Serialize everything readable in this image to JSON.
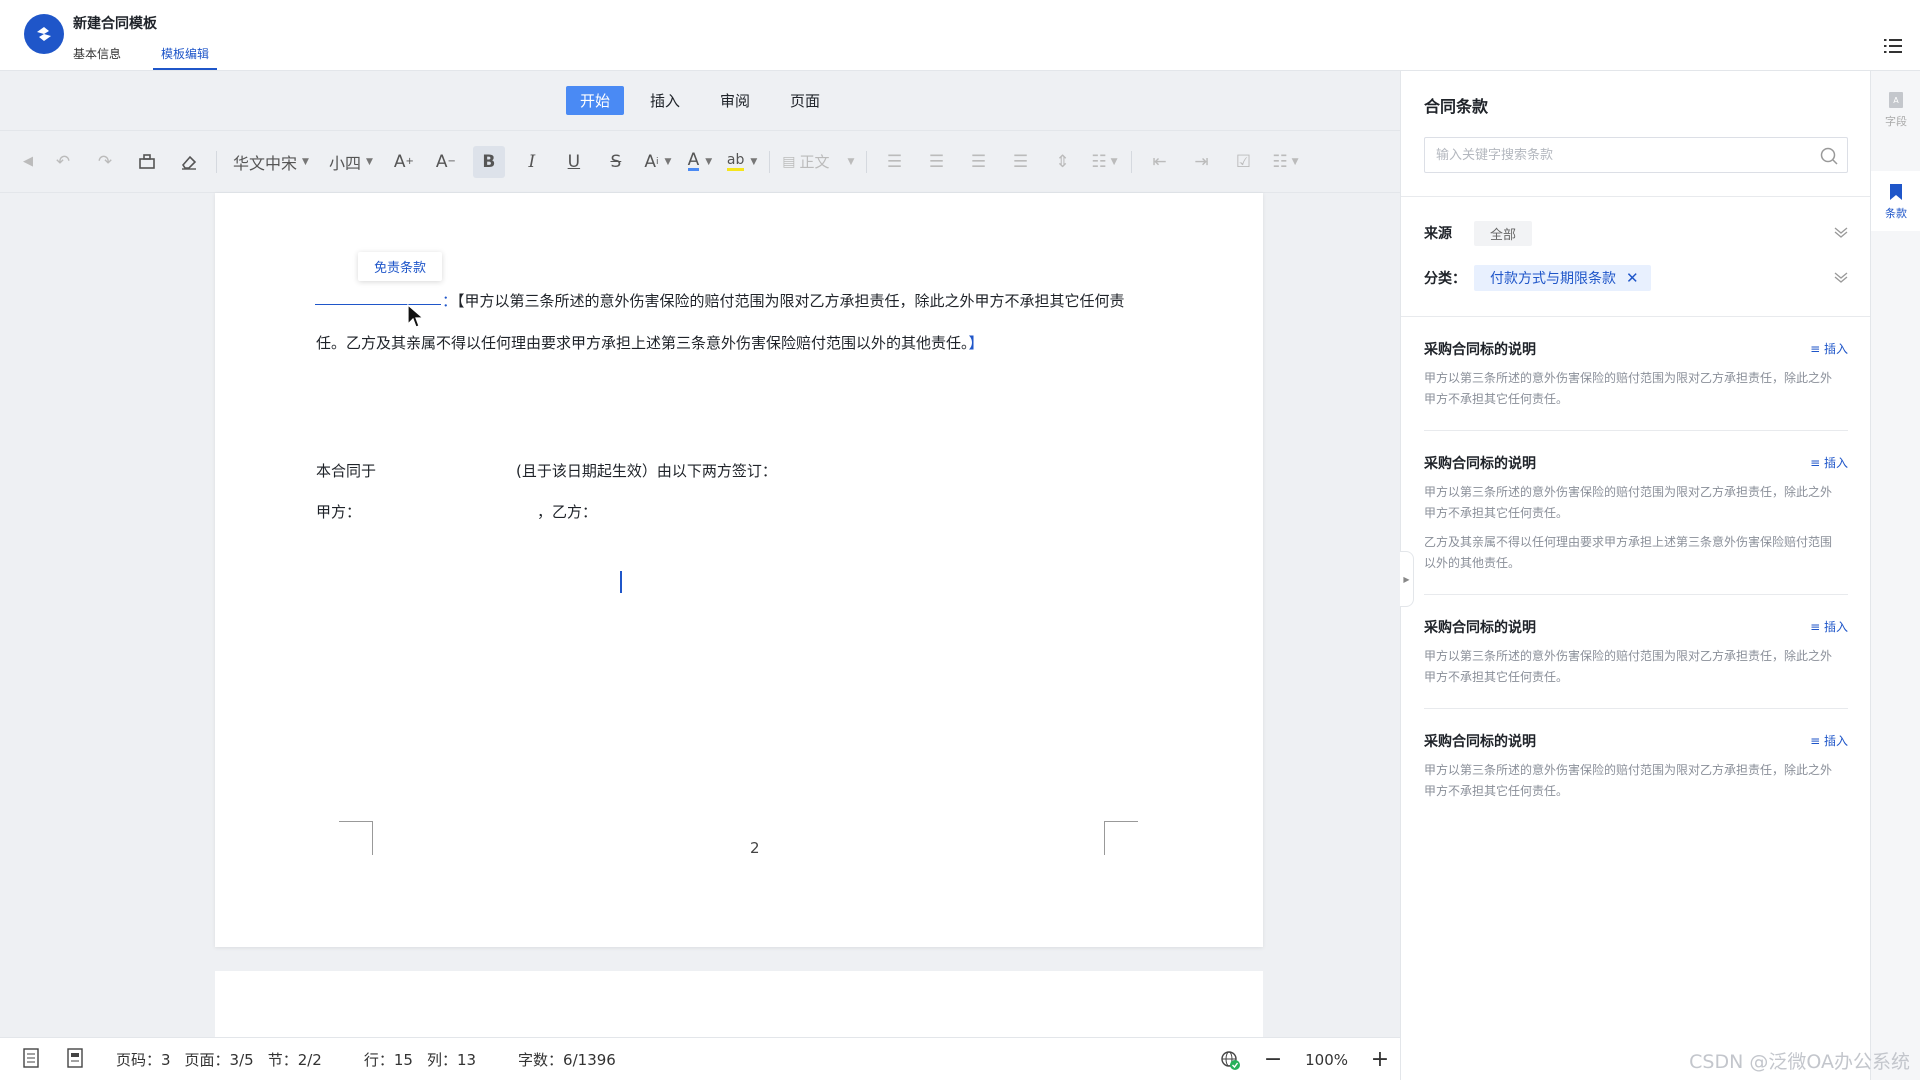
{
  "header": {
    "title": "新建合同模板",
    "tabs": [
      {
        "label": "基本信息"
      },
      {
        "label": "模板编辑"
      }
    ],
    "active_tab": "模板编辑"
  },
  "menu_tabs": [
    {
      "label": "开始"
    },
    {
      "label": "插入"
    },
    {
      "label": "审阅"
    },
    {
      "label": "页面"
    }
  ],
  "active_menu": "开始",
  "toolbar": {
    "font_family": "华文中宋",
    "font_size": "小四",
    "paragraph_style": "正文",
    "font_color": "#4a8af4",
    "highlight_color": "#f5e51b",
    "icons": [
      "back-icon",
      "undo-icon",
      "redo-icon",
      "format-painter-icon",
      "eraser-icon",
      "increase-font-icon",
      "decrease-font-icon",
      "bold-icon",
      "italic-icon",
      "underline-icon",
      "strikethrough-icon",
      "superscript-icon",
      "font-color-icon",
      "highlight-icon",
      "paragraph-style-icon",
      "align-left-icon",
      "align-center-icon",
      "align-right-icon",
      "justify-icon",
      "line-spacing-icon",
      "paragraph-spacing-icon",
      "outdent-icon",
      "indent-icon",
      "checkbox-icon",
      "bulleted-list-icon"
    ]
  },
  "document": {
    "clause_tag": "免责条款",
    "colon": "：",
    "clause_line1": "【甲方以第三条所述的意外伤害保险的赔付范围为限对乙方承担责任，除此之外甲方不承担其它任何责",
    "clause_line2": "任。乙方及其亲属不得以任何理由要求甲方承担上述第三条意外伤害保险赔付范围以外的其他责任。",
    "clause_close": "】",
    "sign_line_a": "本合同于",
    "sign_line_b": "(且于该日期起生效）由以下两方签订：",
    "party_a": "甲方：",
    "party_b": "，乙方：",
    "page_number": "2"
  },
  "statusbar": {
    "page_code": "页码：3",
    "pages": "页面：3/5",
    "section": "节：2/2",
    "row": "行：15",
    "col": "列：13",
    "word_count": "字数：6/1396",
    "zoom": "100%",
    "zoom_out": "−",
    "zoom_in": "+"
  },
  "panel": {
    "title": "合同条款",
    "search_placeholder": "输入关键字搜索条款",
    "source_label": "来源",
    "source_value": "全部",
    "category_label": "分类：",
    "category_value": "付款方式与期限条款",
    "category_close": "✕",
    "insert_label": "插入",
    "clauses": [
      {
        "title": "采购合同标的说明",
        "desc": [
          "甲方以第三条所述的意外伤害保险的赔付范围为限对乙方承担责任，除此之外甲方不承担其它任何责任。"
        ]
      },
      {
        "title": "采购合同标的说明",
        "desc": [
          "甲方以第三条所述的意外伤害保险的赔付范围为限对乙方承担责任，除此之外甲方不承担其它任何责任。",
          "乙方及其亲属不得以任何理由要求甲方承担上述第三条意外伤害保险赔付范围以外的其他责任。"
        ]
      },
      {
        "title": "采购合同标的说明",
        "desc": [
          "甲方以第三条所述的意外伤害保险的赔付范围为限对乙方承担责任，除此之外甲方不承担其它任何责任。"
        ]
      },
      {
        "title": "采购合同标的说明",
        "desc": [
          "甲方以第三条所述的意外伤害保险的赔付范围为限对乙方承担责任，除此之外甲方不承担其它任何责任。"
        ]
      }
    ]
  },
  "strip": {
    "field_label": "字段",
    "clause_label": "条款"
  },
  "watermark": "CSDN @泛微OA办公系统"
}
